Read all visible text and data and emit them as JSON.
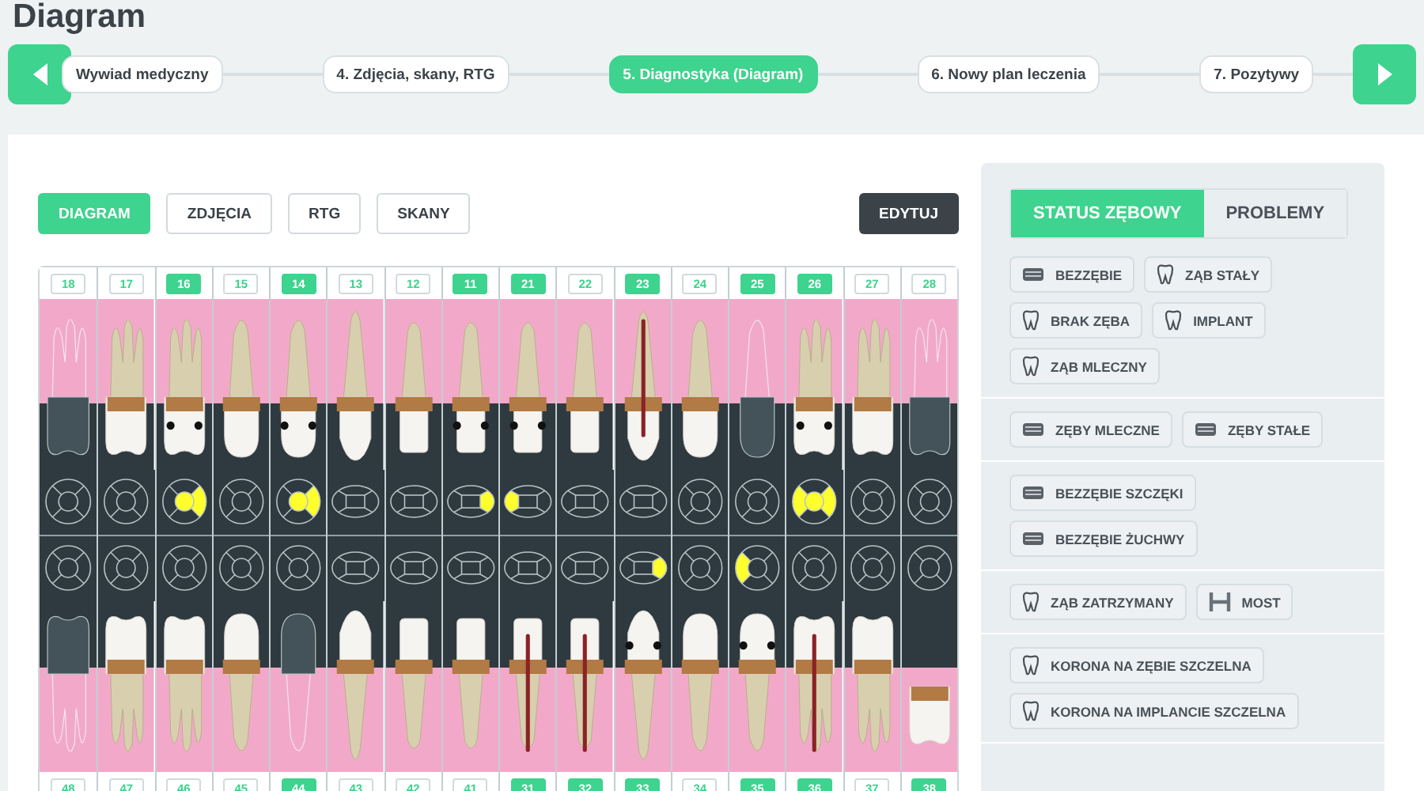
{
  "page_title": "Diagram",
  "steps": [
    {
      "label": "Wywiad medyczny",
      "selected": false
    },
    {
      "label": "4. Zdjęcia, skany, RTG",
      "selected": false
    },
    {
      "label": "5. Diagnostyka (Diagram)",
      "selected": true
    },
    {
      "label": "6. Nowy plan leczenia",
      "selected": false
    },
    {
      "label": "7. Pozytywy",
      "selected": false
    }
  ],
  "view_buttons": [
    {
      "label": "DIAGRAM",
      "selected": true
    },
    {
      "label": "ZDJĘCIA",
      "selected": false
    },
    {
      "label": "RTG",
      "selected": false
    },
    {
      "label": "SKANY",
      "selected": false
    }
  ],
  "edit_button": "EDYTUJ",
  "upper_teeth": [
    {
      "number": "18",
      "selected": false,
      "kind": "molar",
      "missing": true,
      "root_canal": false,
      "caries": false,
      "filled_left": false,
      "filled_center": false,
      "filled_right": false
    },
    {
      "number": "17",
      "selected": false,
      "kind": "molar",
      "missing": false,
      "root_canal": false,
      "caries": false,
      "filled_left": false,
      "filled_center": false,
      "filled_right": false
    },
    {
      "number": "16",
      "selected": true,
      "kind": "molar",
      "missing": false,
      "root_canal": false,
      "caries": true,
      "filled_left": false,
      "filled_center": true,
      "filled_right": true
    },
    {
      "number": "15",
      "selected": false,
      "kind": "premolar",
      "missing": false,
      "root_canal": false,
      "caries": false,
      "filled_left": false,
      "filled_center": false,
      "filled_right": false
    },
    {
      "number": "14",
      "selected": true,
      "kind": "premolar",
      "missing": false,
      "root_canal": false,
      "caries": true,
      "filled_left": false,
      "filled_center": true,
      "filled_right": true
    },
    {
      "number": "13",
      "selected": false,
      "kind": "canine",
      "missing": false,
      "root_canal": false,
      "caries": false,
      "filled_left": false,
      "filled_center": false,
      "filled_right": false
    },
    {
      "number": "12",
      "selected": false,
      "kind": "incisor",
      "missing": false,
      "root_canal": false,
      "caries": false,
      "filled_left": false,
      "filled_center": false,
      "filled_right": false
    },
    {
      "number": "11",
      "selected": true,
      "kind": "incisor",
      "missing": false,
      "root_canal": false,
      "caries": true,
      "filled_left": false,
      "filled_center": false,
      "filled_right": true
    },
    {
      "number": "21",
      "selected": true,
      "kind": "incisor",
      "missing": false,
      "root_canal": false,
      "caries": true,
      "filled_left": true,
      "filled_center": false,
      "filled_right": false
    },
    {
      "number": "22",
      "selected": false,
      "kind": "incisor",
      "missing": false,
      "root_canal": false,
      "caries": false,
      "filled_left": false,
      "filled_center": false,
      "filled_right": false
    },
    {
      "number": "23",
      "selected": true,
      "kind": "canine",
      "missing": false,
      "root_canal": true,
      "caries": false,
      "filled_left": false,
      "filled_center": false,
      "filled_right": false
    },
    {
      "number": "24",
      "selected": false,
      "kind": "premolar",
      "missing": false,
      "root_canal": false,
      "caries": false,
      "filled_left": false,
      "filled_center": false,
      "filled_right": false
    },
    {
      "number": "25",
      "selected": true,
      "kind": "premolar",
      "missing": true,
      "root_canal": false,
      "caries": false,
      "filled_left": false,
      "filled_center": false,
      "filled_right": false
    },
    {
      "number": "26",
      "selected": true,
      "kind": "molar",
      "missing": false,
      "root_canal": false,
      "caries": true,
      "filled_left": true,
      "filled_center": true,
      "filled_right": true
    },
    {
      "number": "27",
      "selected": false,
      "kind": "molar",
      "missing": false,
      "root_canal": false,
      "caries": false,
      "filled_left": false,
      "filled_center": false,
      "filled_right": false
    },
    {
      "number": "28",
      "selected": false,
      "kind": "molar",
      "missing": true,
      "root_canal": false,
      "caries": false,
      "filled_left": false,
      "filled_center": false,
      "filled_right": false
    }
  ],
  "lower_teeth": [
    {
      "number": "48",
      "selected": false,
      "kind": "molar",
      "missing": true,
      "root_canal": false,
      "caries": false,
      "displaced": false,
      "filled_left": false,
      "filled_center": false,
      "filled_right": false
    },
    {
      "number": "47",
      "selected": false,
      "kind": "molar",
      "missing": false,
      "root_canal": false,
      "caries": false,
      "displaced": false,
      "filled_left": false,
      "filled_center": false,
      "filled_right": false
    },
    {
      "number": "46",
      "selected": false,
      "kind": "molar",
      "missing": false,
      "root_canal": false,
      "caries": false,
      "displaced": false,
      "filled_left": false,
      "filled_center": false,
      "filled_right": false
    },
    {
      "number": "45",
      "selected": false,
      "kind": "premolar",
      "missing": false,
      "root_canal": false,
      "caries": false,
      "displaced": false,
      "filled_left": false,
      "filled_center": false,
      "filled_right": false
    },
    {
      "number": "44",
      "selected": true,
      "kind": "premolar",
      "missing": true,
      "root_canal": false,
      "caries": false,
      "displaced": false,
      "filled_left": false,
      "filled_center": false,
      "filled_right": false
    },
    {
      "number": "43",
      "selected": false,
      "kind": "canine",
      "missing": false,
      "root_canal": false,
      "caries": false,
      "displaced": false,
      "filled_left": false,
      "filled_center": false,
      "filled_right": false
    },
    {
      "number": "42",
      "selected": false,
      "kind": "incisor",
      "missing": false,
      "root_canal": false,
      "caries": false,
      "displaced": false,
      "filled_left": false,
      "filled_center": false,
      "filled_right": false
    },
    {
      "number": "41",
      "selected": false,
      "kind": "incisor",
      "missing": false,
      "root_canal": false,
      "caries": false,
      "displaced": false,
      "filled_left": false,
      "filled_center": false,
      "filled_right": false
    },
    {
      "number": "31",
      "selected": true,
      "kind": "incisor",
      "missing": false,
      "root_canal": true,
      "caries": false,
      "displaced": false,
      "filled_left": false,
      "filled_center": false,
      "filled_right": false
    },
    {
      "number": "32",
      "selected": true,
      "kind": "incisor",
      "missing": false,
      "root_canal": true,
      "caries": false,
      "displaced": false,
      "filled_left": false,
      "filled_center": false,
      "filled_right": false
    },
    {
      "number": "33",
      "selected": true,
      "kind": "canine",
      "missing": false,
      "root_canal": false,
      "caries": true,
      "displaced": false,
      "filled_left": false,
      "filled_center": false,
      "filled_right": true
    },
    {
      "number": "34",
      "selected": false,
      "kind": "premolar",
      "missing": false,
      "root_canal": false,
      "caries": false,
      "displaced": false,
      "filled_left": false,
      "filled_center": false,
      "filled_right": false
    },
    {
      "number": "35",
      "selected": true,
      "kind": "premolar",
      "missing": false,
      "root_canal": false,
      "caries": true,
      "displaced": false,
      "filled_left": true,
      "filled_center": false,
      "filled_right": false
    },
    {
      "number": "36",
      "selected": true,
      "kind": "molar",
      "missing": false,
      "root_canal": true,
      "caries": false,
      "displaced": false,
      "filled_left": false,
      "filled_center": false,
      "filled_right": false
    },
    {
      "number": "37",
      "selected": false,
      "kind": "molar",
      "missing": false,
      "root_canal": false,
      "caries": false,
      "displaced": false,
      "filled_left": false,
      "filled_center": false,
      "filled_right": false
    },
    {
      "number": "38",
      "selected": true,
      "kind": "molar",
      "missing": false,
      "root_canal": false,
      "caries": false,
      "displaced": true,
      "filled_left": false,
      "filled_center": false,
      "filled_right": false
    }
  ],
  "panel_tabs": [
    {
      "label": "STATUS ZĘBOWY",
      "selected": true
    },
    {
      "label": "PROBLEMY",
      "selected": false
    }
  ],
  "status_groups": [
    [
      {
        "label": "BEZZĘBIE",
        "kind": "jaw"
      },
      {
        "label": "ZĄB STAŁY",
        "kind": "tooth"
      },
      {
        "label": "BRAK ZĘBA",
        "kind": "tooth"
      },
      {
        "label": "IMPLANT",
        "kind": "tooth"
      },
      {
        "label": "ZĄB MLECZNY",
        "kind": "tooth"
      }
    ],
    [
      {
        "label": "ZĘBY MLECZNE",
        "kind": "jaw"
      },
      {
        "label": "ZĘBY STAŁE",
        "kind": "jaw"
      }
    ],
    [
      {
        "label": "BEZZĘBIE SZCZĘKI",
        "kind": "jaw"
      },
      {
        "label": "BEZZĘBIE ŻUCHWY",
        "kind": "jaw"
      }
    ],
    [
      {
        "label": "ZĄB ZATRZYMANY",
        "kind": "tooth"
      },
      {
        "label": "MOST",
        "kind": "bridge"
      }
    ],
    [
      {
        "label": "KORONA NA ZĘBIE SZCZELNA",
        "kind": "tooth"
      },
      {
        "label": "KORONA NA IMPLANCIE SZCZELNA",
        "kind": "tooth"
      }
    ]
  ]
}
